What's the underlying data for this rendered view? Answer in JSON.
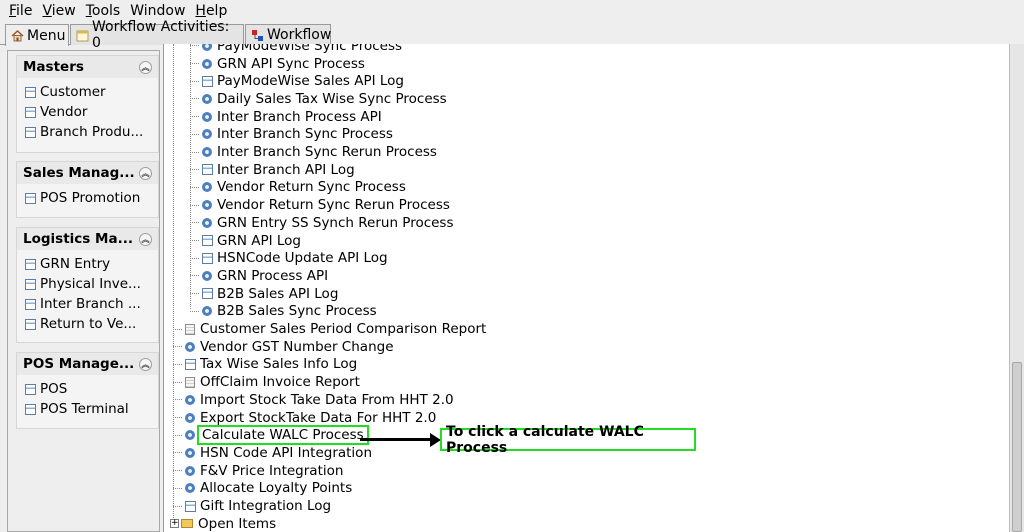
{
  "menubar": [
    {
      "label": "File",
      "ul": "F",
      "rest": "ile"
    },
    {
      "label": "View",
      "ul": "V",
      "rest": "iew"
    },
    {
      "label": "Tools",
      "ul": "T",
      "rest": "ools"
    },
    {
      "label": "Window",
      "ul": "",
      "rest": "Window"
    },
    {
      "label": "Help",
      "ul": "H",
      "rest": "elp"
    }
  ],
  "tabs": {
    "menu": "Menu",
    "workflow_activities": "Workflow Activities: 0",
    "workflow": "Workflow"
  },
  "sidebar": {
    "masters": {
      "title": "Masters",
      "items": [
        "Customer",
        "Vendor",
        "Branch Produ..."
      ]
    },
    "sales": {
      "title": "Sales Manag...",
      "items": [
        "POS Promotion"
      ]
    },
    "logistics": {
      "title": "Logistics Ma...",
      "items": [
        "GRN Entry",
        "Physical Inve...",
        "Inter Branch ...",
        "Return to Ve..."
      ]
    },
    "pos": {
      "title": "POS Manage...",
      "items": [
        "POS",
        "POS Terminal"
      ]
    }
  },
  "tree": {
    "sub_items": [
      {
        "label": "PayModeWise Sync Process",
        "icon": "gear-icon"
      },
      {
        "label": "GRN API Sync Process",
        "icon": "gear-icon"
      },
      {
        "label": "PayModeWise Sales API Log",
        "icon": "log-icon"
      },
      {
        "label": "Daily Sales Tax Wise Sync Process",
        "icon": "gear-icon"
      },
      {
        "label": "Inter Branch Process API",
        "icon": "gear-icon"
      },
      {
        "label": "Inter Branch Sync Process",
        "icon": "gear-icon"
      },
      {
        "label": "Inter Branch Sync Rerun Process",
        "icon": "gear-icon"
      },
      {
        "label": "Inter Branch API Log",
        "icon": "log-icon"
      },
      {
        "label": "Vendor Return Sync Process",
        "icon": "gear-icon"
      },
      {
        "label": "Vendor Return Sync Rerun Process",
        "icon": "gear-icon"
      },
      {
        "label": "GRN Entry SS Synch Rerun Process",
        "icon": "gear-icon"
      },
      {
        "label": "GRN API Log",
        "icon": "log-icon"
      },
      {
        "label": "HSNCode Update API Log",
        "icon": "log-icon"
      },
      {
        "label": "GRN Process API",
        "icon": "gear-icon"
      },
      {
        "label": "B2B Sales API Log",
        "icon": "log-icon"
      },
      {
        "label": "B2B Sales Sync Process",
        "icon": "gear-icon"
      }
    ],
    "top_items": [
      {
        "label": "Customer Sales Period Comparison Report",
        "icon": "report-icon"
      },
      {
        "label": "Vendor GST Number Change",
        "icon": "gear-icon"
      },
      {
        "label": "Tax Wise Sales Info Log",
        "icon": "log-icon"
      },
      {
        "label": "OffClaim Invoice Report",
        "icon": "report-icon"
      },
      {
        "label": "Import Stock Take Data From HHT 2.0",
        "icon": "gear-icon"
      },
      {
        "label": "Export StockTake Data For HHT 2.0",
        "icon": "gear-icon"
      },
      {
        "label": "Calculate WALC Process",
        "icon": "gear-icon"
      },
      {
        "label": "HSN Code API Integration",
        "icon": "gear-icon"
      },
      {
        "label": "F&V Price Integration",
        "icon": "gear-icon"
      },
      {
        "label": "Allocate Loyalty Points",
        "icon": "gear-icon"
      },
      {
        "label": "Gift Integration Log",
        "icon": "log-icon"
      },
      {
        "label": "Open Items",
        "icon": "folder-icon"
      }
    ]
  },
  "annotation": {
    "text": "To click a calculate WALC Process"
  }
}
